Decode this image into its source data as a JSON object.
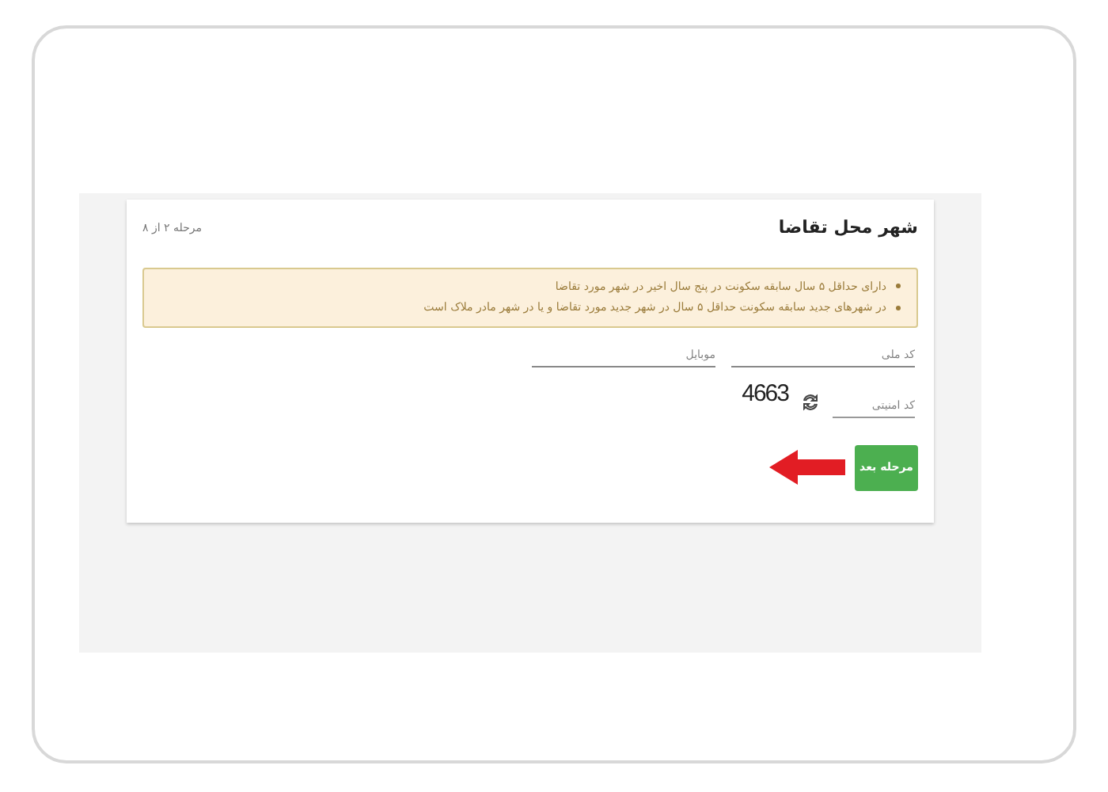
{
  "header": {
    "title": "شهر محل تقاضا",
    "step": "مرحله ۲ از ۸"
  },
  "notice": {
    "items": [
      "دارای حداقل ۵ سال سابقه سکونت در پنج سال اخیر در شهر مورد تقاضا",
      "در شهرهای جدید سابقه سکونت حداقل ۵ سال در شهر جدید مورد تقاضا و یا در شهر مادر ملاک است"
    ]
  },
  "fields": [
    {
      "placeholder": "کد ملی"
    },
    {
      "placeholder": "موبایل"
    }
  ],
  "captcha": {
    "code": "4663",
    "placeholder": "کد امنیتی"
  },
  "next_button": {
    "label": "مرحله بعد"
  }
}
